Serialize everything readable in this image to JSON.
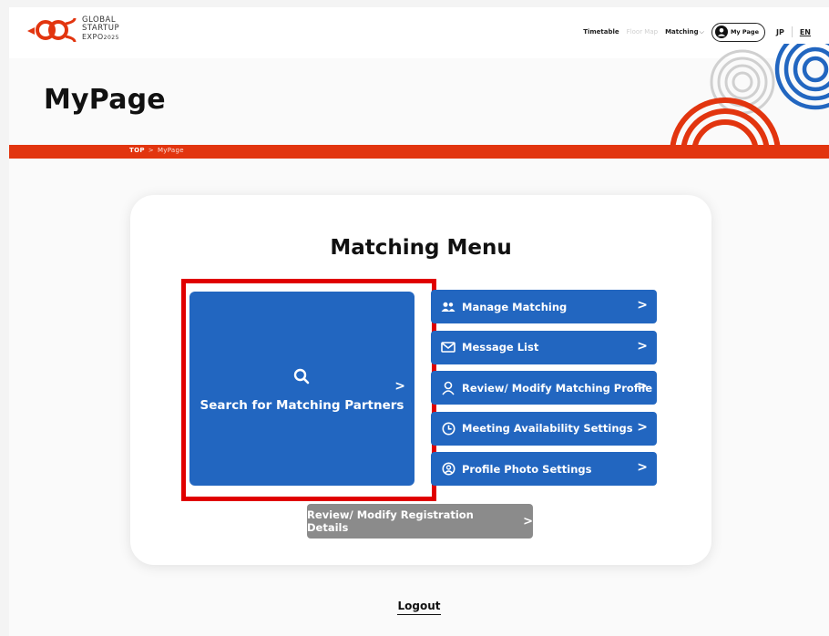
{
  "header": {
    "logo_lines": [
      "GLOBAL",
      "STARTUP",
      "EXPO",
      "2025"
    ],
    "nav": {
      "timetable": "Timetable",
      "floor_map": "Floor Map",
      "matching": "Matching",
      "my_page": "My Page",
      "lang_jp": "JP",
      "lang_en": "EN"
    }
  },
  "hero": {
    "title": "MyPage"
  },
  "breadcrumb": {
    "top": "TOP",
    "separator": ">",
    "current": "MyPage"
  },
  "matching_menu": {
    "title": "Matching Menu",
    "primary": {
      "label": "Search for Matching Partners",
      "icon": "search-icon"
    },
    "items": [
      {
        "label": "Manage Matching",
        "icon": "users-icon"
      },
      {
        "label": "Message List",
        "icon": "mail-icon"
      },
      {
        "label": "Review/ Modify Matching Profile",
        "icon": "person-icon"
      },
      {
        "label": "Meeting Availability Settings",
        "icon": "clock-icon"
      },
      {
        "label": "Profile Photo Settings",
        "icon": "profile-photo-icon"
      }
    ],
    "secondary_button": "Review/ Modify Registration Details",
    "chevron": ">"
  },
  "footer": {
    "logout": "Logout"
  },
  "colors": {
    "brand_red": "#e2350f",
    "button_blue": "#2266c0",
    "button_grey": "#8b8b8b",
    "highlight": "#e00000"
  }
}
